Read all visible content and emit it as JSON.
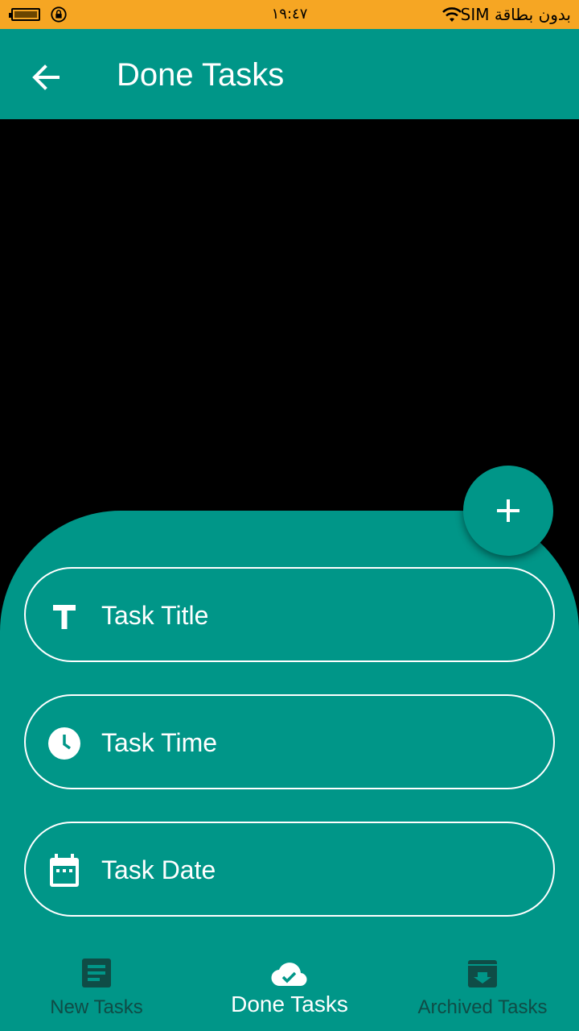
{
  "status_bar": {
    "time": "١٩:٤٧",
    "carrier": "بدون بطاقة SIM",
    "color": "#F6A623"
  },
  "app_bar": {
    "title": "Done Tasks",
    "back_icon": "arrow-back-icon",
    "color": "#009688"
  },
  "form": {
    "fields": [
      {
        "label": "Task Title",
        "icon": "title-icon"
      },
      {
        "label": "Task Time",
        "icon": "clock-icon"
      },
      {
        "label": "Task Date",
        "icon": "calendar-icon"
      }
    ]
  },
  "fab": {
    "icon": "add-icon"
  },
  "bottom_nav": {
    "items": [
      {
        "label": "New Tasks",
        "icon": "list-icon",
        "active": false
      },
      {
        "label": "Done Tasks",
        "icon": "cloud-done-icon",
        "active": true
      },
      {
        "label": "Archived Tasks",
        "icon": "archive-icon",
        "active": false
      }
    ],
    "active_color": "#FFFFFF",
    "inactive_color": "#0F4C46"
  }
}
